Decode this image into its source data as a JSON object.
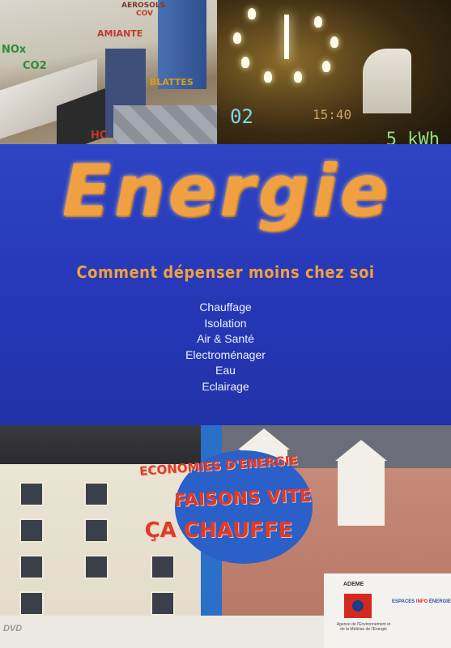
{
  "top_band": {
    "kitchen_labels": [
      "AEROSOLS",
      "COV",
      "AMIANTE",
      "NOx",
      "CO2",
      "BLATTES",
      "HC"
    ],
    "display_left": "02",
    "display_right": "15:40",
    "energy_reading": "5 kWh"
  },
  "title": "Energie",
  "subtitle": "Comment dépenser moins  chez soi",
  "topics": [
    "Chauffage",
    "Isolation",
    "Air & Santé",
    "Electroménager",
    "Eau",
    "Eclairage"
  ],
  "slogan": {
    "line1": "ECONOMIES D'ENERGIE",
    "line2": "FAISONS VITE",
    "line3": "ÇA CHAUFFE"
  },
  "logos": {
    "ademe_name": "ADEME",
    "ademe_subtitle": "Agence de l'Environnement et de la Maîtrise de l'Energie",
    "eie_prefix": "ESPACES",
    "eie_highlight": "INFO",
    "eie_suffix": "ÉNERGIE"
  },
  "format_mark": "DVD"
}
